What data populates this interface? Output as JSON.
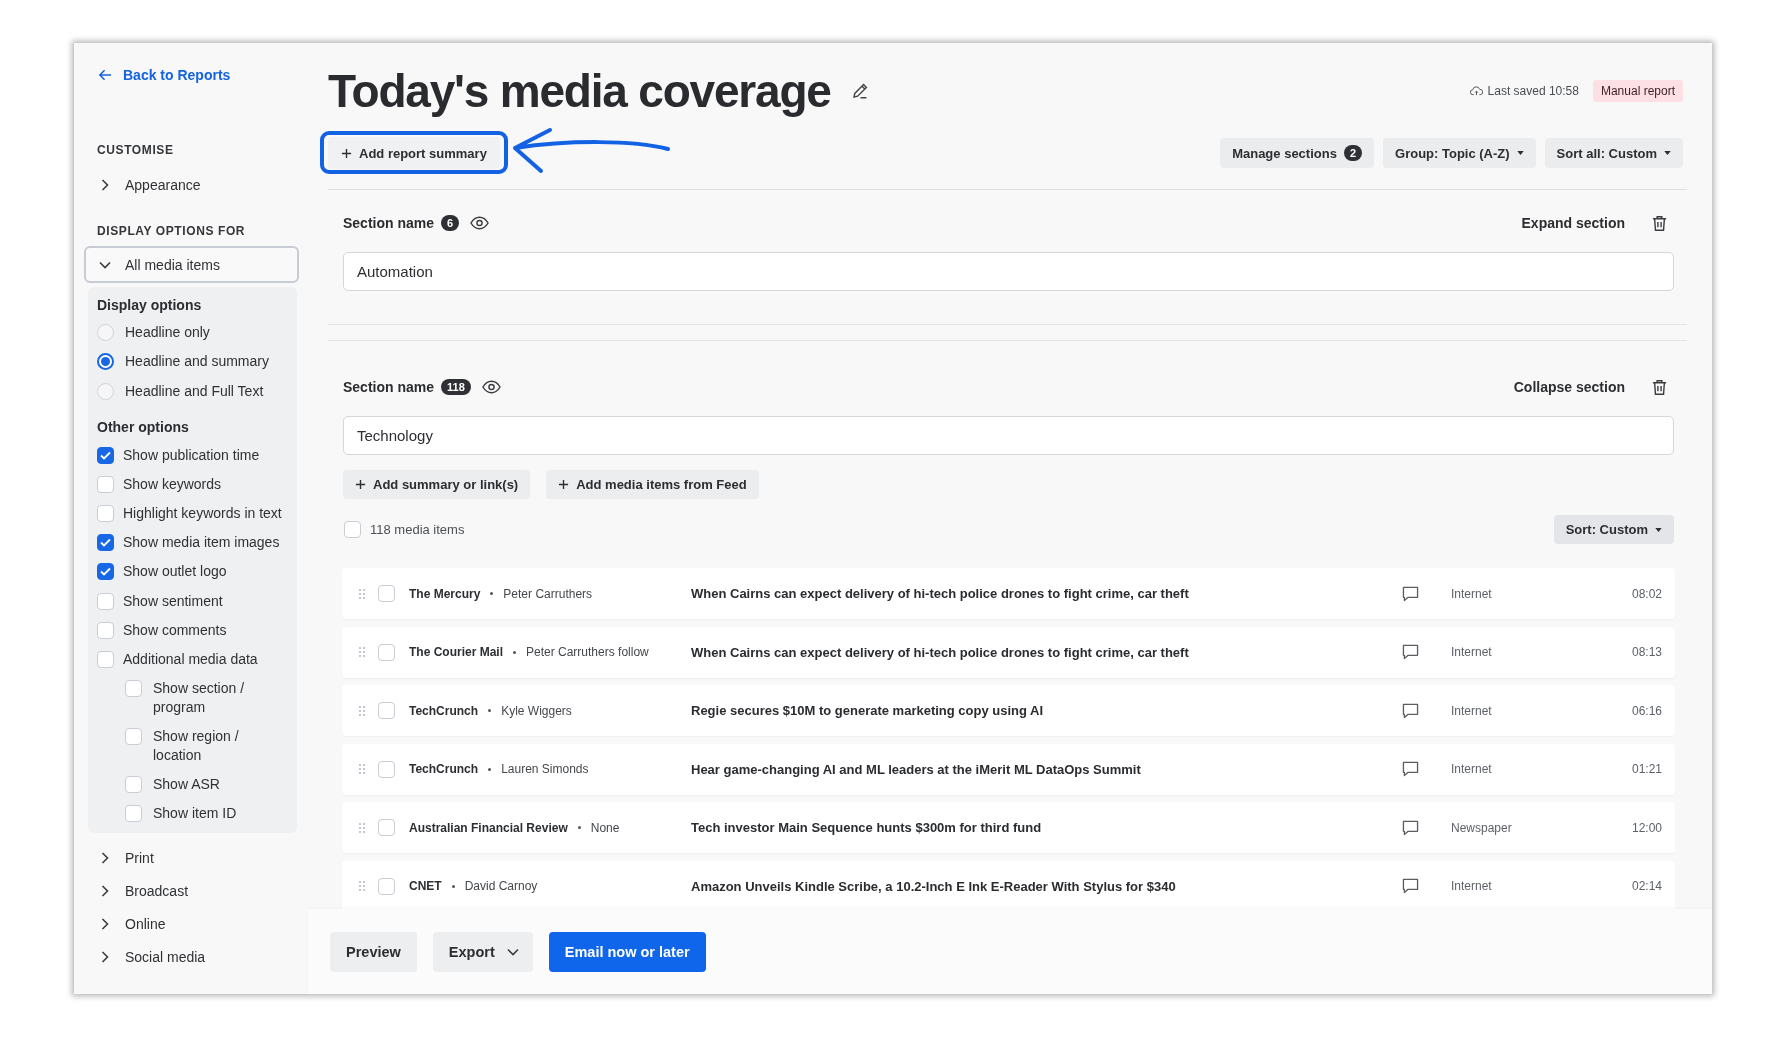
{
  "back_link": {
    "label": "Back to Reports"
  },
  "sidebar": {
    "customise": {
      "heading": "CUSTOMISE",
      "items": [
        {
          "label": "Appearance",
          "expanded": false
        }
      ]
    },
    "display_for": {
      "heading": "DISPLAY OPTIONS FOR",
      "dropdown": {
        "value": "All media items",
        "expanded": true
      }
    },
    "display_options": {
      "heading": "Display options",
      "options": [
        {
          "label": "Headline only",
          "selected": false
        },
        {
          "label": "Headline and summary",
          "selected": true
        },
        {
          "label": "Headline and Full Text",
          "selected": false
        }
      ]
    },
    "other_options": {
      "heading": "Other options",
      "items": [
        {
          "label": "Show publication time",
          "checked": true
        },
        {
          "label": "Show keywords",
          "checked": false
        },
        {
          "label": "Highlight keywords in text",
          "checked": false
        },
        {
          "label": "Show media item images",
          "checked": true
        },
        {
          "label": "Show outlet logo",
          "checked": true
        },
        {
          "label": "Show sentiment",
          "checked": false
        },
        {
          "label": "Show comments",
          "checked": false
        },
        {
          "label": "Additional media data",
          "checked": false,
          "children": [
            {
              "label": "Show section / program",
              "checked": false
            },
            {
              "label": "Show region / location",
              "checked": false
            },
            {
              "label": "Show ASR",
              "checked": false
            },
            {
              "label": "Show item ID",
              "checked": false
            }
          ]
        }
      ]
    },
    "media_groups": [
      {
        "label": "Print",
        "expanded": false
      },
      {
        "label": "Broadcast",
        "expanded": false
      },
      {
        "label": "Online",
        "expanded": false
      },
      {
        "label": "Social media",
        "expanded": false
      }
    ]
  },
  "header": {
    "title": "Today's media coverage",
    "last_saved": "Last saved 10:58",
    "report_type": "Manual report"
  },
  "toolbar": {
    "add_report_summary": {
      "label": "Add report summary",
      "highlighted": true
    },
    "manage_sections": {
      "label": "Manage sections",
      "count": "2"
    },
    "group_menu": {
      "label": "Group: Topic (A-Z)"
    },
    "sort_menu": {
      "label": "Sort all: Custom"
    }
  },
  "sections": [
    {
      "label": "Section name",
      "count": "6",
      "name": "Automation",
      "toggle_label": "Expand section"
    },
    {
      "label": "Section name",
      "count": "118",
      "name": "Technology",
      "toggle_label": "Collapse section",
      "actions": [
        "Add summary or link(s)",
        "Add media items from Feed"
      ],
      "select_all": {
        "label": "118 media items",
        "checked": false
      },
      "sort_menu": {
        "label": "Sort: Custom"
      },
      "items": [
        {
          "outlet": "The Mercury",
          "author": "Peter Carruthers",
          "headline": "When Cairns can expect delivery of hi-tech police drones to fight crime, car theft",
          "media_type": "Internet",
          "time": "08:02",
          "checked": false
        },
        {
          "outlet": "The Courier Mail",
          "author": "Peter Carruthers follow",
          "headline": "When Cairns can expect delivery of hi-tech police drones to fight crime, car theft",
          "media_type": "Internet",
          "time": "08:13",
          "checked": false
        },
        {
          "outlet": "TechCrunch",
          "author": "Kyle Wiggers",
          "headline": "Regie secures $10M to generate marketing copy using AI",
          "media_type": "Internet",
          "time": "06:16",
          "checked": false
        },
        {
          "outlet": "TechCrunch",
          "author": "Lauren Simonds",
          "headline": "Hear game-changing AI and ML leaders at the iMerit ML DataOps Summit",
          "media_type": "Internet",
          "time": "01:21",
          "checked": false
        },
        {
          "outlet": "Australian Financial Review",
          "author": "None",
          "headline": "Tech investor Main Sequence hunts $300m for third fund",
          "media_type": "Newspaper",
          "time": "12:00",
          "checked": false
        },
        {
          "outlet": "CNET",
          "author": "David Carnoy",
          "headline": "Amazon Unveils Kindle Scribe, a 10.2-Inch E Ink E-Reader With Stylus for $340",
          "media_type": "Internet",
          "time": "02:14",
          "checked": false
        }
      ]
    }
  ],
  "footer": {
    "buttons": [
      {
        "label": "Preview",
        "kind": "plain"
      },
      {
        "label": "Export",
        "kind": "menu"
      },
      {
        "label": "Email now or later",
        "kind": "primary"
      }
    ]
  }
}
